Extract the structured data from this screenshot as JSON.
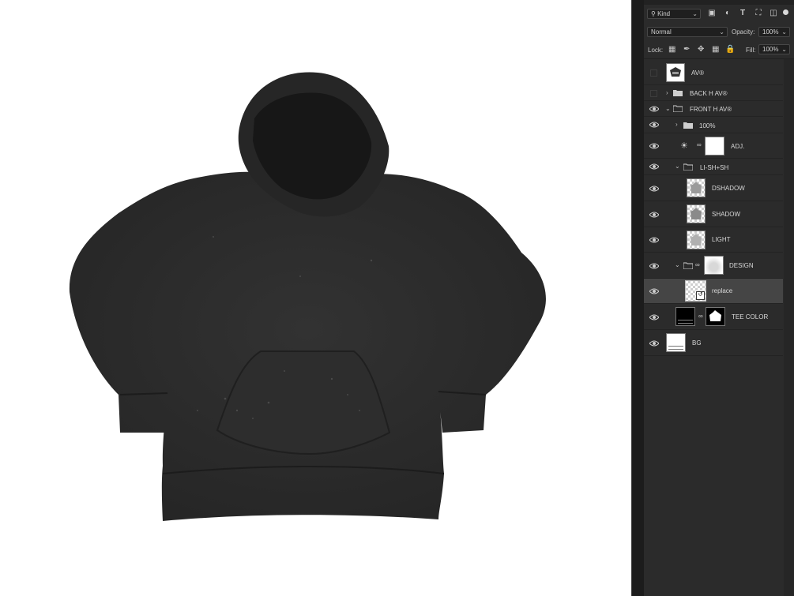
{
  "layers_panel": {
    "filter": {
      "value": "Kind",
      "icon": "search-icon"
    },
    "blend_mode": {
      "value": "Normal"
    },
    "opacity": {
      "label": "Opacity:",
      "value": "100%"
    },
    "lock": {
      "label": "Lock:"
    },
    "fill": {
      "label": "Fill:",
      "value": "100%"
    },
    "layers": [
      {
        "name": "AV®",
        "kind": "smart-object",
        "visible": false
      },
      {
        "name": "BACK H AV®",
        "kind": "group",
        "visible": false,
        "expanded": false
      },
      {
        "name": "FRONT H AV®",
        "kind": "group",
        "visible": true,
        "expanded": true
      },
      {
        "name": "100%",
        "kind": "group",
        "visible": true,
        "expanded": false
      },
      {
        "name": "ADJ.",
        "kind": "adjustment",
        "visible": true
      },
      {
        "name": "LI-SH+SH",
        "kind": "group",
        "visible": true,
        "expanded": true
      },
      {
        "name": "DSHADOW",
        "kind": "layer",
        "visible": true
      },
      {
        "name": "SHADOW",
        "kind": "layer",
        "visible": true
      },
      {
        "name": "LIGHT",
        "kind": "layer",
        "visible": true
      },
      {
        "name": "DESIGN",
        "kind": "group",
        "visible": true,
        "expanded": true
      },
      {
        "name": "replace",
        "kind": "smart-object",
        "visible": true,
        "selected": true
      },
      {
        "name": "TEE COLOR",
        "kind": "layer-with-mask",
        "visible": true
      },
      {
        "name": "BG",
        "kind": "layer",
        "visible": true
      }
    ]
  },
  "colors": {
    "panel_bg": "#2b2b2b",
    "selected_row": "#454545",
    "garment": "#2a2a2a"
  }
}
